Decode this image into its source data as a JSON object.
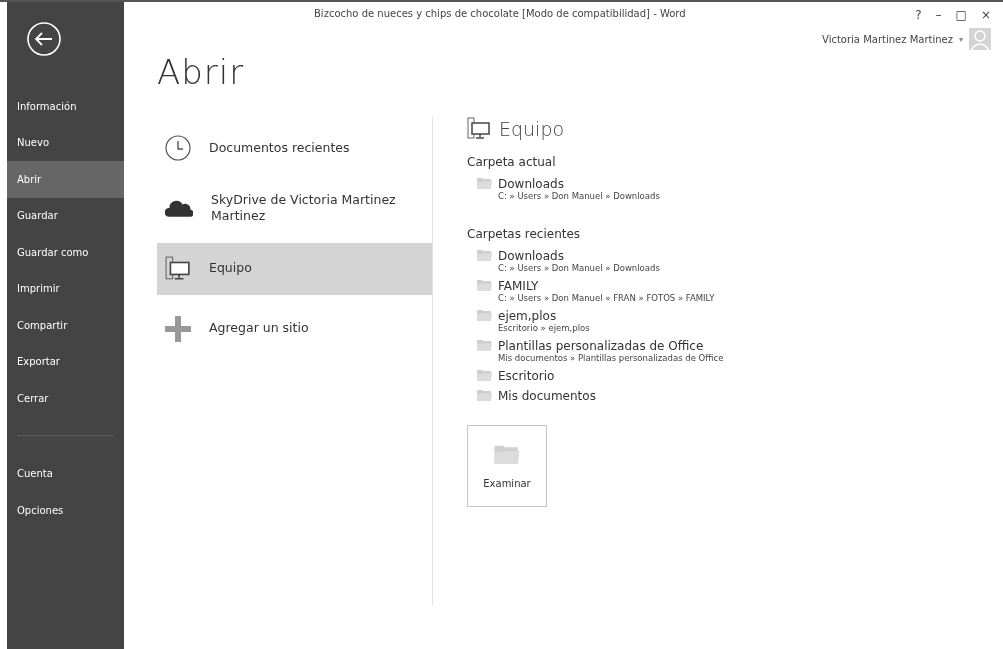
{
  "window": {
    "title": "Bizcocho de nueces y chips de chocolate [Modo de compatibilidad] - Word",
    "controls": [
      "?",
      "–",
      "□",
      "×"
    ],
    "user": "Victoria Martinez Martinez",
    "user_caret": "▾"
  },
  "sidebar": {
    "items": [
      {
        "label": "Información",
        "selected": false
      },
      {
        "label": "Nuevo",
        "selected": false
      },
      {
        "label": "Abrir",
        "selected": true
      },
      {
        "label": "Guardar",
        "selected": false
      },
      {
        "label": "Guardar como",
        "selected": false
      },
      {
        "label": "Imprimir",
        "selected": false
      },
      {
        "label": "Compartir",
        "selected": false
      },
      {
        "label": "Exportar",
        "selected": false
      },
      {
        "label": "Cerrar",
        "selected": false
      }
    ],
    "bottom_items": [
      {
        "label": "Cuenta",
        "selected": false
      },
      {
        "label": "Opciones",
        "selected": false
      }
    ]
  },
  "heading": "Abrir",
  "places": [
    {
      "kind": "clock",
      "label": "Documentos recientes",
      "selected": false
    },
    {
      "kind": "cloud",
      "label": "SkyDrive de Victoria Martinez Martinez",
      "selected": false
    },
    {
      "kind": "computer",
      "label": "Equipo",
      "selected": true
    },
    {
      "kind": "plus",
      "label": "Agregar un sitio",
      "selected": false
    }
  ],
  "detail": {
    "title": "Equipo",
    "current": {
      "heading": "Carpeta actual",
      "folders": [
        {
          "name": "Downloads",
          "path": "C: » Users » Don Manuel » Downloads"
        }
      ]
    },
    "recent": {
      "heading": "Carpetas recientes",
      "folders": [
        {
          "name": "Downloads",
          "path": "C: » Users » Don Manuel » Downloads"
        },
        {
          "name": "FAMILY",
          "path": "C: » Users » Don Manuel » FRAN » FOTOS » FAMILY"
        },
        {
          "name": "ejem,plos",
          "path": "Escritorio » ejem,plos"
        },
        {
          "name": "Plantillas personalizadas de Office",
          "path": "Mis documentos » Plantillas personalizadas de Office"
        },
        {
          "name": "Escritorio"
        },
        {
          "name": "Mis documentos"
        }
      ]
    },
    "browse": "Examinar"
  }
}
